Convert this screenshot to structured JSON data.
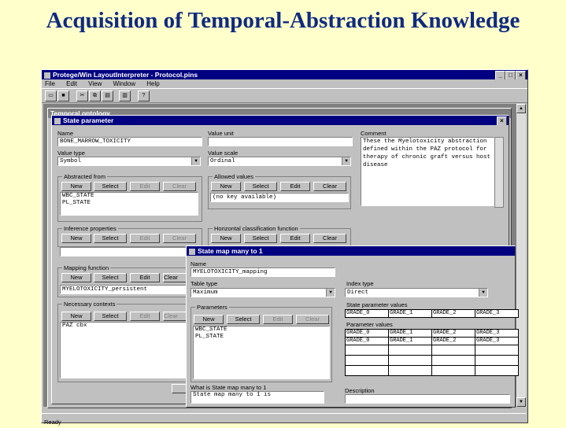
{
  "slide": {
    "title": "Acquisition of Temporal-Abstraction Knowledge"
  },
  "app": {
    "title": "Protege/Win LayoutInterpreter - Protocol.pins",
    "menu": [
      "File",
      "Edit",
      "View",
      "Window",
      "Help"
    ],
    "toolbar_icons": [
      "new-file-icon",
      "save-icon",
      "cut-icon",
      "copy-icon",
      "paste-icon",
      "print-icon",
      "help-icon"
    ],
    "status": "Ready"
  },
  "bg_window": {
    "title": "Temporal ontology"
  },
  "state_param": {
    "title": "State parameter",
    "name_label": "Name",
    "name_value": "BONE_MARROW_TOXICITY",
    "value_unit_label": "Value unit",
    "value_unit": "",
    "comment_label": "Comment",
    "comment": "These the Myelotoxicity abstraction defined within the PAZ protocol for therapy of chronic graft versus host disease",
    "value_type_label": "Value type",
    "value_type": "Symbol",
    "value_scale_label": "Value scale",
    "value_scale": "Ordinal",
    "abstracted_from_label": "Abstracted from",
    "abstracted_from": [
      "WBC_STATE",
      "PL_STATE"
    ],
    "allowed_values_label": "Allowed values",
    "allowed_values_text": "(no key available)",
    "inference_label": "Inference properties",
    "horizontal_label": "Horizontal classification function",
    "mapping_label": "Mapping function",
    "mapping_value": "MYELOTOXICITY_persistent",
    "contexts_label": "Necessary contexts",
    "contexts": [
      "PAZ cbx"
    ],
    "buttons": {
      "new": "New",
      "select": "Select",
      "edit": "Edit",
      "clear": "Clear"
    }
  },
  "state_map": {
    "title": "State map many to 1",
    "name_label": "Name",
    "name_value": "MYELOTOXICITY_mapping",
    "table_type_label": "Table type",
    "table_type": "Maximum",
    "index_type_label": "Index type",
    "index_type": "Direct",
    "params_label": "Parameters",
    "params": [
      "WBC_STATE",
      "PL_STATE"
    ],
    "state_values_label": "State parameter values",
    "state_values": [
      "GRADE_0",
      "GRADE_1",
      "GRADE_2",
      "GRADE_3"
    ],
    "param_values_label": "Parameter values",
    "param_values": [
      [
        "GRADE_0",
        "GRADE_1",
        "GRADE_2",
        "GRADE_3"
      ],
      [
        "GRADE_0",
        "GRADE_1",
        "GRADE_2",
        "GRADE_3"
      ],
      [
        "",
        "",
        "",
        ""
      ],
      [
        "",
        "",
        "",
        ""
      ],
      [
        "",
        "",
        "",
        ""
      ]
    ],
    "what_is_label": "What is State map many to 1",
    "what_is_value": "State map many to 1 is",
    "description_label": "Description",
    "buttons": {
      "new": "New",
      "select": "Select",
      "edit": "Edit",
      "clear": "Clear"
    }
  },
  "colors": {
    "slide_bg": "#ffffcc",
    "title": "#102a80",
    "window": "#c0c0c0",
    "titlebar": "#000080"
  }
}
